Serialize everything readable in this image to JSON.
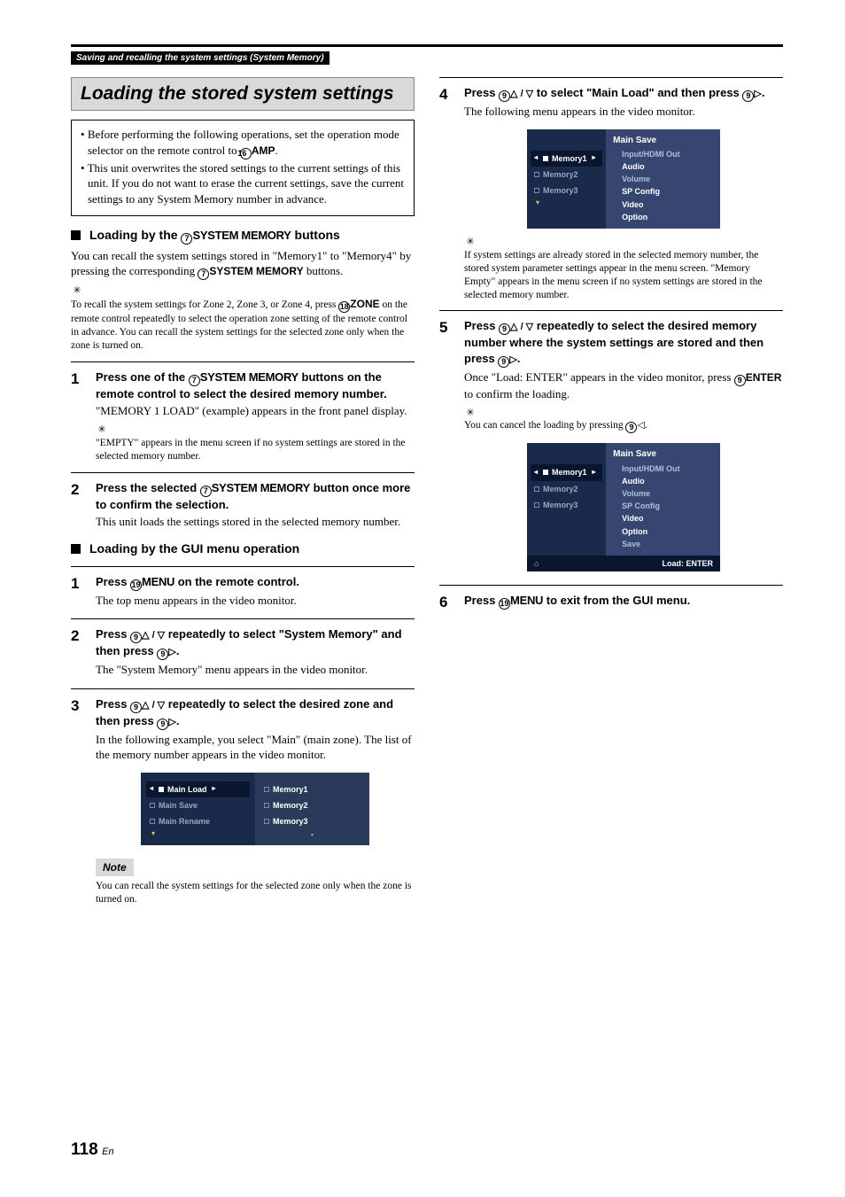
{
  "breadcrumb": "Saving and recalling the system settings (System Memory)",
  "title": "Loading the stored system settings",
  "intro": {
    "b1a": "Before performing the following operations, set the operation mode selector on the remote control to ",
    "b1_icon": "⑯",
    "b1_label": "AMP",
    "b1b": ".",
    "b2": "This unit overwrites the stored settings to the current settings of this unit. If you do not want to erase the current settings, save the current settings to any System Memory number in advance."
  },
  "sectionA": {
    "h_pre": "Loading by the ",
    "h_icon": "⑦",
    "h_btn": "SYSTEM MEMORY",
    "h_post": " buttons",
    "p1a": "You can recall the system settings stored in \"Memory1\" to \"Memory4\" by pressing the corresponding ",
    "p1_icon": "⑦",
    "p1_btn": "SYSTEM MEMORY",
    "p1b": " buttons.",
    "tip_a": "To recall the system settings for Zone 2, Zone 3, or Zone 4, press ",
    "tip_icon": "⑱",
    "tip_btn": "ZONE",
    "tip_b": " on the remote control repeatedly to select the operation zone setting of the remote control in advance. You can recall the system settings for the selected zone only when the zone is turned on."
  },
  "leftSteps": {
    "s1": {
      "h_a": "Press one of the ",
      "h_icon": "⑦",
      "h_btn": "SYSTEM MEMORY",
      "h_b": " buttons on the remote control to select the desired memory number.",
      "p": "\"MEMORY 1 LOAD\" (example) appears in the front panel display.",
      "tip": "\"EMPTY\" appears in the menu screen if no system settings are stored in the selected memory number."
    },
    "s2": {
      "h_a": "Press the selected ",
      "h_icon": "⑦",
      "h_btn": "SYSTEM MEMORY",
      "h_b": " button once more to confirm the selection.",
      "p": "This unit loads the settings stored in the selected memory number."
    }
  },
  "sectionB": {
    "h": "Loading by the GUI menu operation"
  },
  "guiSteps": {
    "s1": {
      "h_a": "Press ",
      "h_icon": "⑲",
      "h_btn": "MENU",
      "h_b": " on the remote control.",
      "p": "The top menu appears in the video monitor."
    },
    "s2": {
      "h_a": "Press ",
      "h_icon": "⑨",
      "h_mid": " repeatedly to select \"System Memory\" and then press ",
      "h_icon2": "⑨",
      "h_end": ".",
      "p": "The \"System Memory\" menu appears in the video monitor."
    },
    "s3": {
      "h_a": "Press ",
      "h_icon": "⑨",
      "h_mid": " repeatedly to select the desired zone and then press ",
      "h_icon2": "⑨",
      "h_end": ".",
      "p": "In the following example, you select \"Main\" (main zone). The list of the memory number appears in the video monitor."
    }
  },
  "gui1": {
    "left": [
      "Main Load",
      "Main Save",
      "Main Rename"
    ],
    "right": [
      "Memory1",
      "Memory2",
      "Memory3"
    ]
  },
  "note": {
    "label": "Note",
    "text": "You can recall the system settings for the selected zone only when the zone is turned on."
  },
  "rightSteps": {
    "s4": {
      "h_a": "Press ",
      "h_icon": "⑨",
      "h_mid": " to select \"Main Load\" and then press ",
      "h_icon2": "⑨",
      "h_end": ".",
      "p": "The following menu appears in the video monitor.",
      "tip": "If system settings are already stored in the selected memory number, the stored system parameter settings appear in the menu screen. \"Memory Empty\" appears in the menu screen if no system settings are stored in the selected memory number."
    },
    "s5": {
      "h_a": "Press ",
      "h_icon": "⑨",
      "h_mid": " repeatedly to select the desired memory number where the system settings are stored and then press ",
      "h_icon2": "⑨",
      "h_end": ".",
      "p_a": "Once \"Load: ENTER\" appears in the video monitor, press ",
      "p_icon": "⑨",
      "p_btn": "ENTER",
      "p_b": " to confirm the loading.",
      "tip_a": "You can cancel the loading by pressing ",
      "tip_icon": "⑨",
      "tip_b": "."
    },
    "s6": {
      "h_a": "Press ",
      "h_icon": "⑲",
      "h_btn": "MENU",
      "h_b": " to exit from the GUI menu."
    }
  },
  "gui2": {
    "title": "Main Save",
    "subs": [
      "Input/HDMI Out",
      "Audio",
      "Volume",
      "SP Config",
      "Video",
      "Option"
    ],
    "save": "Save",
    "left": [
      "Memory1",
      "Memory2",
      "Memory3"
    ],
    "footer": "Load: ENTER"
  },
  "page": {
    "num": "118",
    "lang": "En"
  }
}
